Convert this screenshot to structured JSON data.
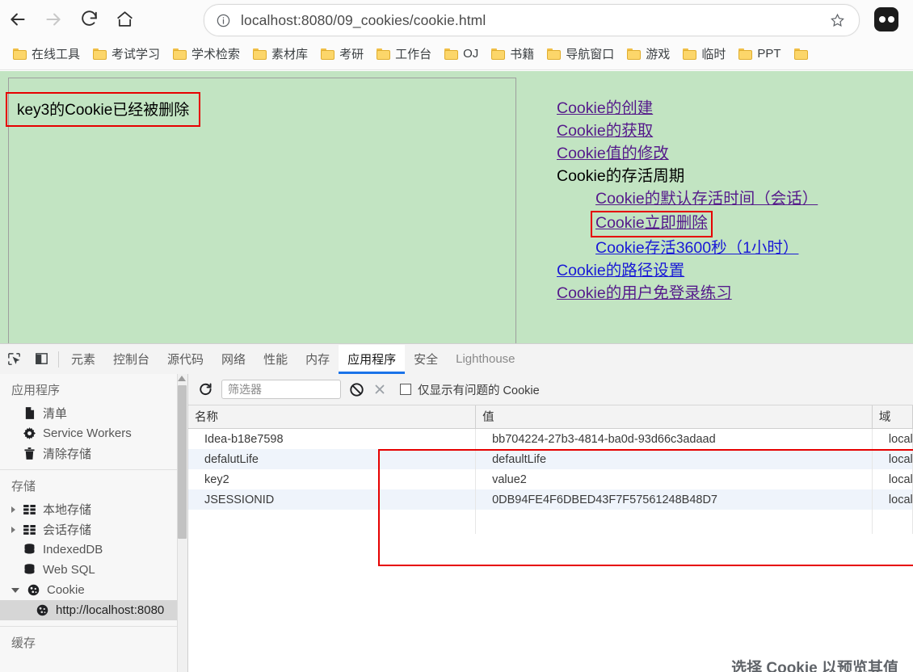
{
  "browser": {
    "back_icon": "back-arrow-icon",
    "forward_icon": "forward-arrow-icon",
    "reload_icon": "reload-icon",
    "home_icon": "home-icon",
    "url_full": "localhost:8080/09_cookies/cookie.html",
    "url_host": "localhost:8080",
    "url_path": "/09_cookies/cookie.html",
    "info_icon": "info-circle-icon",
    "star_icon": "bookmark-star-icon",
    "profile_icon": "profile-avatar-icon"
  },
  "bookmarks": [
    {
      "label": "在线工具"
    },
    {
      "label": "考试学习"
    },
    {
      "label": "学术检索"
    },
    {
      "label": "素材库"
    },
    {
      "label": "考研"
    },
    {
      "label": "工作台"
    },
    {
      "label": "OJ"
    },
    {
      "label": "书籍"
    },
    {
      "label": "导航窗口"
    },
    {
      "label": "游戏"
    },
    {
      "label": "临时"
    },
    {
      "label": "PPT"
    }
  ],
  "page": {
    "background_color": "#c2e4c2",
    "message": "key3的Cookie已经被删除",
    "highlight_color": "#e60000",
    "links": [
      {
        "label": "Cookie的创建",
        "state": "visited",
        "indent": 0,
        "highlighted": false
      },
      {
        "label": "Cookie的获取",
        "state": "visited",
        "indent": 0,
        "highlighted": false
      },
      {
        "label": "Cookie值的修改",
        "state": "visited",
        "indent": 0,
        "highlighted": false
      },
      {
        "label": "Cookie的存活周期",
        "state": "plain",
        "indent": 0,
        "highlighted": false
      },
      {
        "label": "Cookie的默认存活时间（会话）",
        "state": "visited",
        "indent": 1,
        "highlighted": false
      },
      {
        "label": "Cookie立即删除",
        "state": "visited",
        "indent": 1,
        "highlighted": true
      },
      {
        "label": "Cookie存活3600秒（1小时）",
        "state": "unvisited",
        "indent": 1,
        "highlighted": false
      },
      {
        "label": "Cookie的路径设置",
        "state": "unvisited",
        "indent": 0,
        "highlighted": false
      },
      {
        "label": "Cookie的用户免登录练习",
        "state": "visited",
        "indent": 0,
        "highlighted": false
      }
    ]
  },
  "devtools": {
    "inspect_icon": "inspect-element-icon",
    "device_icon": "device-toolbar-icon",
    "tabs": [
      {
        "label": "元素",
        "active": false,
        "muted": false
      },
      {
        "label": "控制台",
        "active": false,
        "muted": false
      },
      {
        "label": "源代码",
        "active": false,
        "muted": false
      },
      {
        "label": "网络",
        "active": false,
        "muted": false
      },
      {
        "label": "性能",
        "active": false,
        "muted": false
      },
      {
        "label": "内存",
        "active": false,
        "muted": false
      },
      {
        "label": "应用程序",
        "active": true,
        "muted": false
      },
      {
        "label": "安全",
        "active": false,
        "muted": false
      },
      {
        "label": "Lighthouse",
        "active": false,
        "muted": true
      }
    ],
    "sidebar": {
      "sections": [
        {
          "title": "应用程序",
          "items": [
            {
              "label": "清单",
              "icon": "manifest-file-icon",
              "indent": 0,
              "expandable": false,
              "selected": false
            },
            {
              "label": "Service Workers",
              "icon": "gear-icon",
              "indent": 0,
              "expandable": false,
              "selected": false
            },
            {
              "label": "清除存储",
              "icon": "trash-icon",
              "indent": 0,
              "expandable": false,
              "selected": false
            }
          ]
        },
        {
          "title": "存储",
          "items": [
            {
              "label": "本地存储",
              "icon": "table-grid-icon",
              "indent": 0,
              "expandable": true,
              "expanded": false,
              "selected": false
            },
            {
              "label": "会话存储",
              "icon": "table-grid-icon",
              "indent": 0,
              "expandable": true,
              "expanded": false,
              "selected": false
            },
            {
              "label": "IndexedDB",
              "icon": "database-icon",
              "indent": 0,
              "expandable": false,
              "selected": false
            },
            {
              "label": "Web SQL",
              "icon": "database-icon",
              "indent": 0,
              "expandable": false,
              "selected": false
            },
            {
              "label": "Cookie",
              "icon": "cookie-icon",
              "indent": 0,
              "expandable": true,
              "expanded": true,
              "selected": false
            },
            {
              "label": "http://localhost:8080",
              "icon": "cookie-icon",
              "indent": 1,
              "expandable": false,
              "selected": true
            }
          ]
        },
        {
          "title": "缓存",
          "items": []
        }
      ]
    },
    "cookie_panel": {
      "refresh_icon": "refresh-icon",
      "clear_icon": "clear-all-cookies-icon",
      "close_icon": "close-x-icon",
      "filter_placeholder": "筛选器",
      "filter_value": "",
      "checkbox_label": "仅显示有问题的 Cookie",
      "checkbox_checked": false,
      "columns": [
        "名称",
        "值",
        "域"
      ],
      "rows": [
        {
          "name": "Idea-b18e7598",
          "value": "bb704224-27b3-4814-ba0d-93d66c3adaad",
          "domain": "localh"
        },
        {
          "name": "defalutLife",
          "value": "defaultLife",
          "domain": "localh"
        },
        {
          "name": "key2",
          "value": "value2",
          "domain": "localh"
        },
        {
          "name": "JSESSIONID",
          "value": "0DB94FE4F6DBED43F7F57561248B48D7",
          "domain": "localh"
        }
      ],
      "preview_hint": "选择 Cookie 以预览其值"
    }
  }
}
